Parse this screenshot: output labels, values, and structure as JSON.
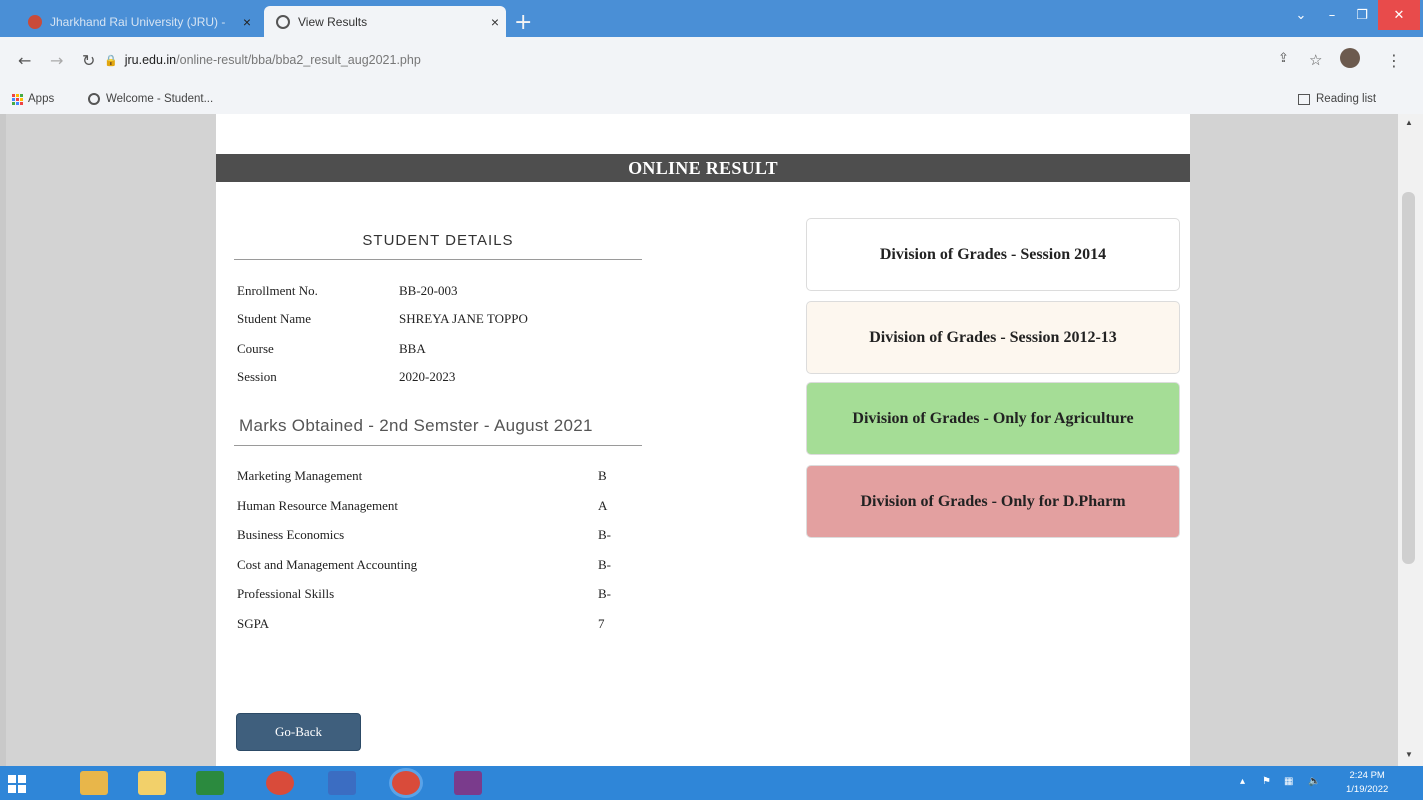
{
  "browser": {
    "tabs": [
      {
        "title": "Jharkhand Rai University (JRU) - ",
        "active": false
      },
      {
        "title": "View Results",
        "active": true
      }
    ],
    "new_tab_label": "+",
    "close_label": "×",
    "url_domain": "jru.edu.in",
    "url_path": "/online-result/bba/bba2_result_aug2021.php",
    "bookmarks": [
      {
        "label": "Apps",
        "icon": "apps-grid-icon"
      },
      {
        "label": "Welcome - Student...",
        "icon": "globe-icon"
      }
    ],
    "reading_list": "Reading list"
  },
  "page": {
    "banner": "ONLINE RESULT",
    "student_details_heading": "STUDENT DETAILS",
    "details": [
      {
        "label": "Enrollment No.",
        "value": "BB-20-003"
      },
      {
        "label": "Student Name",
        "value": "SHREYA JANE TOPPO"
      },
      {
        "label": "Course",
        "value": "BBA"
      },
      {
        "label": "Session",
        "value": "2020-2023"
      }
    ],
    "marks_heading": "Marks Obtained - 2nd Semster - August 2021",
    "marks": [
      {
        "subject": "Marketing Management",
        "grade": "B"
      },
      {
        "subject": "Human Resource Management",
        "grade": "A"
      },
      {
        "subject": "Business Economics",
        "grade": "B-"
      },
      {
        "subject": "Cost and Management Accounting",
        "grade": "B-"
      },
      {
        "subject": "Professional Skills",
        "grade": "B-"
      },
      {
        "subject": "SGPA",
        "grade": "7"
      }
    ],
    "grade_links": [
      {
        "label": "Division of Grades - Session 2014",
        "color": "#ffffff"
      },
      {
        "label": "Division of Grades - Session 2012-13",
        "color": "#fdf7ef"
      },
      {
        "label": "Division of Grades - Only for Agriculture",
        "color": "#a5dd96"
      },
      {
        "label": "Division of Grades - Only for D.Pharm",
        "color": "#e3a0a0"
      }
    ],
    "go_back": "Go-Back"
  },
  "taskbar": {
    "time": "2:24 PM",
    "date": "1/19/2022"
  }
}
